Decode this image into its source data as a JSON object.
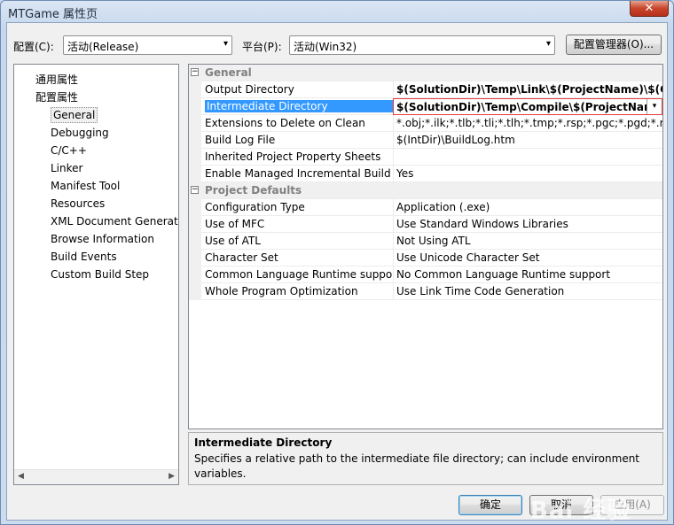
{
  "window": {
    "title": "MTGame 属性页",
    "close_glyph": "✕"
  },
  "toolbar": {
    "config_label": "配置(C):",
    "config_value": "活动(Release)",
    "platform_label": "平台(P):",
    "platform_value": "活动(Win32)",
    "config_manager_button": "配置管理器(O)..."
  },
  "tree": {
    "items": [
      {
        "label": "通用属性",
        "level": 0
      },
      {
        "label": "配置属性",
        "level": 0
      },
      {
        "label": "General",
        "level": 1,
        "selected": true
      },
      {
        "label": "Debugging",
        "level": 1
      },
      {
        "label": "C/C++",
        "level": 1
      },
      {
        "label": "Linker",
        "level": 1
      },
      {
        "label": "Manifest Tool",
        "level": 1
      },
      {
        "label": "Resources",
        "level": 1
      },
      {
        "label": "XML Document Generat",
        "level": 1
      },
      {
        "label": "Browse Information",
        "level": 1
      },
      {
        "label": "Build Events",
        "level": 1
      },
      {
        "label": "Custom Build Step",
        "level": 1
      }
    ]
  },
  "grid": {
    "rows": [
      {
        "type": "category",
        "name": "General",
        "toggle": "−"
      },
      {
        "name": "Output Directory",
        "value": "$(SolutionDir)\\Temp\\Link\\$(ProjectName)\\$(Con",
        "bold": true
      },
      {
        "name": "Intermediate Directory",
        "value": "$(SolutionDir)\\Temp\\Compile\\$(ProjectName",
        "bold": true,
        "selected": true
      },
      {
        "name": "Extensions to Delete on Clean",
        "value": "*.obj;*.ilk;*.tlb;*.tli;*.tlh;*.tmp;*.rsp;*.pgc;*.pgd;*.meta;$"
      },
      {
        "name": "Build Log File",
        "value": "$(IntDir)\\BuildLog.htm"
      },
      {
        "name": "Inherited Project Property Sheets",
        "value": ""
      },
      {
        "name": "Enable Managed Incremental Build",
        "value": "Yes"
      },
      {
        "type": "category",
        "name": "Project Defaults",
        "toggle": "−"
      },
      {
        "name": "Configuration Type",
        "value": "Application (.exe)"
      },
      {
        "name": "Use of MFC",
        "value": "Use Standard Windows Libraries"
      },
      {
        "name": "Use of ATL",
        "value": "Not Using ATL"
      },
      {
        "name": "Character Set",
        "value": "Use Unicode Character Set"
      },
      {
        "name": "Common Language Runtime suppor",
        "value": "No Common Language Runtime support"
      },
      {
        "name": "Whole Program Optimization",
        "value": "Use Link Time Code Generation"
      }
    ]
  },
  "description": {
    "title": "Intermediate Directory",
    "text": "Specifies a relative path to the intermediate file directory; can include environment variables."
  },
  "buttons": {
    "ok": "确定",
    "cancel": "取消",
    "apply": "应用(A)"
  },
  "watermark": "Bai 经验",
  "icons": {
    "dropdown": "▾",
    "scroll_left": "◀",
    "scroll_right": "▶"
  }
}
